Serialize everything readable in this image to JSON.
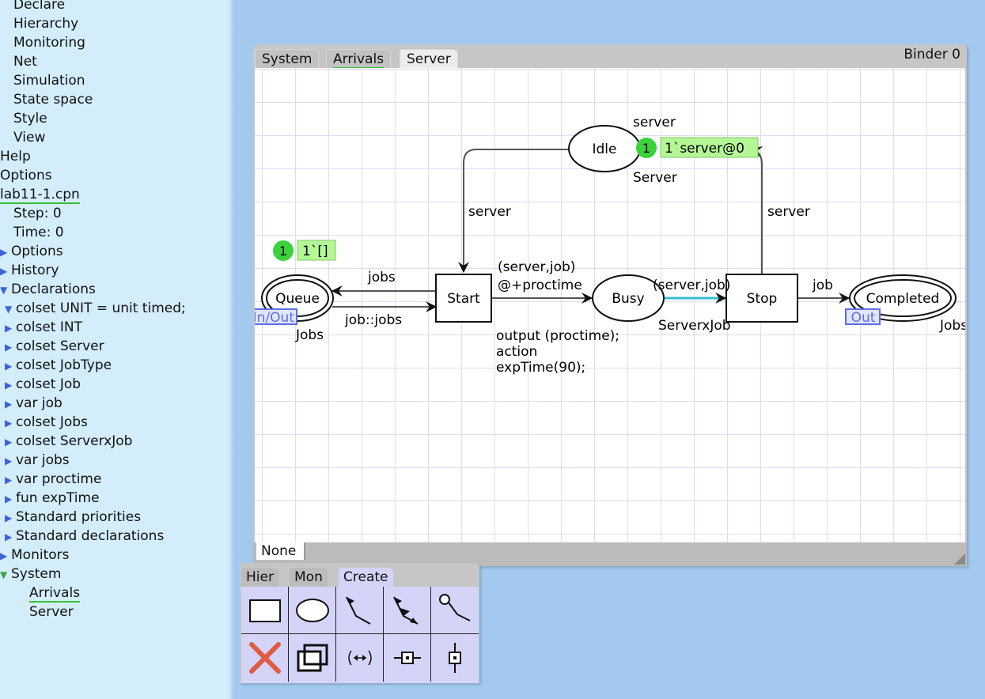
{
  "index": {
    "items": [
      {
        "label": "Declare",
        "indent": 17,
        "tri": ""
      },
      {
        "label": "Hierarchy",
        "indent": 17,
        "tri": ""
      },
      {
        "label": "Monitoring",
        "indent": 17,
        "tri": ""
      },
      {
        "label": "Net",
        "indent": 17,
        "tri": ""
      },
      {
        "label": "Simulation",
        "indent": 17,
        "tri": ""
      },
      {
        "label": "State space",
        "indent": 17,
        "tri": ""
      },
      {
        "label": "Style",
        "indent": 17,
        "tri": ""
      },
      {
        "label": "View",
        "indent": 17,
        "tri": ""
      },
      {
        "label": "Help",
        "indent": 0,
        "tri": ""
      },
      {
        "label": "Options",
        "indent": 0,
        "tri": ""
      },
      {
        "label": "lab11-1.cpn",
        "indent": 0,
        "tri": "",
        "underline": true
      },
      {
        "label": "Step: 0",
        "indent": 17,
        "tri": ""
      },
      {
        "label": "Time: 0",
        "indent": 17,
        "tri": ""
      },
      {
        "label": "Options",
        "indent": 0,
        "tri": "closed"
      },
      {
        "label": "History",
        "indent": 0,
        "tri": "closed"
      },
      {
        "label": "Declarations",
        "indent": 0,
        "tri": "open"
      },
      {
        "label": "colset UNIT = unit timed;",
        "indent": 20,
        "tri": "open"
      },
      {
        "label": "colset INT",
        "indent": 20,
        "tri": "closed"
      },
      {
        "label": "colset Server",
        "indent": 20,
        "tri": "closed"
      },
      {
        "label": "colset JobType",
        "indent": 20,
        "tri": "closed"
      },
      {
        "label": "colset Job",
        "indent": 20,
        "tri": "closed"
      },
      {
        "label": "var job",
        "indent": 20,
        "tri": "closed"
      },
      {
        "label": "colset Jobs",
        "indent": 20,
        "tri": "closed"
      },
      {
        "label": "colset ServerxJob",
        "indent": 20,
        "tri": "closed"
      },
      {
        "label": "var jobs",
        "indent": 20,
        "tri": "closed"
      },
      {
        "label": "var proctime",
        "indent": 20,
        "tri": "closed"
      },
      {
        "label": "fun expTime",
        "indent": 20,
        "tri": "closed"
      },
      {
        "label": "Standard priorities",
        "indent": 20,
        "tri": "closed"
      },
      {
        "label": "Standard declarations",
        "indent": 20,
        "tri": "closed"
      },
      {
        "label": "Monitors",
        "indent": 0,
        "tri": "closed"
      },
      {
        "label": "System",
        "indent": 0,
        "tri": "open-green"
      },
      {
        "label": "Arrivals",
        "indent": 37,
        "tri": "",
        "underline": true
      },
      {
        "label": "Server",
        "indent": 37,
        "tri": ""
      }
    ],
    "triangle_closed": "▶",
    "triangle_open": "▼"
  },
  "binder": {
    "title": "Binder 0",
    "tabs": [
      "System",
      "Arrivals",
      "Server"
    ],
    "active_tab": "Server",
    "bottom_tab": "None"
  },
  "net": {
    "places": {
      "idle": {
        "name": "Idle",
        "colset": "Server",
        "colset_top": "server"
      },
      "queue": {
        "name": "Queue",
        "colset": "Jobs",
        "port": "In/Out"
      },
      "busy": {
        "name": "Busy",
        "colset": "ServerxJob"
      },
      "completed": {
        "name": "Completed",
        "colset": "Jobs",
        "port": "Out"
      }
    },
    "transitions": {
      "start": {
        "name": "Start",
        "code": [
          "output (proctime);",
          "action",
          "expTime(90);"
        ]
      },
      "stop": {
        "name": "Stop"
      }
    },
    "arcs": {
      "idle_start": "server",
      "stop_idle": "server",
      "start_queue": "jobs",
      "queue_start": "job::jobs",
      "start_busy_1": "(server,job)",
      "start_busy_2": "@+proctime",
      "busy_stop": "(server,job)",
      "stop_completed": "job"
    },
    "markings": {
      "idle": {
        "count": "1",
        "value": "1`server@0"
      },
      "queue": {
        "count": "1",
        "value": "1`[]"
      }
    }
  },
  "palette": {
    "tabs": [
      "Hier",
      "Mon",
      "Create"
    ],
    "active_tab": "Create",
    "tools": [
      "transition-tool",
      "place-tool",
      "arc-tool",
      "double-arc-tool",
      "reset-arc-tool",
      "delete-tool",
      "clone-tool",
      "toggle-arc-direction-tool",
      "fusion-port-tool",
      "substitution-tool"
    ]
  },
  "colors": {
    "background": "#a3c9ee",
    "index_bg": "#d4edfb",
    "token_green": "#3cd23c",
    "marking_bg": "#b4f896",
    "port_blue": "#5d6ee8",
    "active_arc": "#2fbfcf",
    "delete_red": "#e05a40"
  }
}
